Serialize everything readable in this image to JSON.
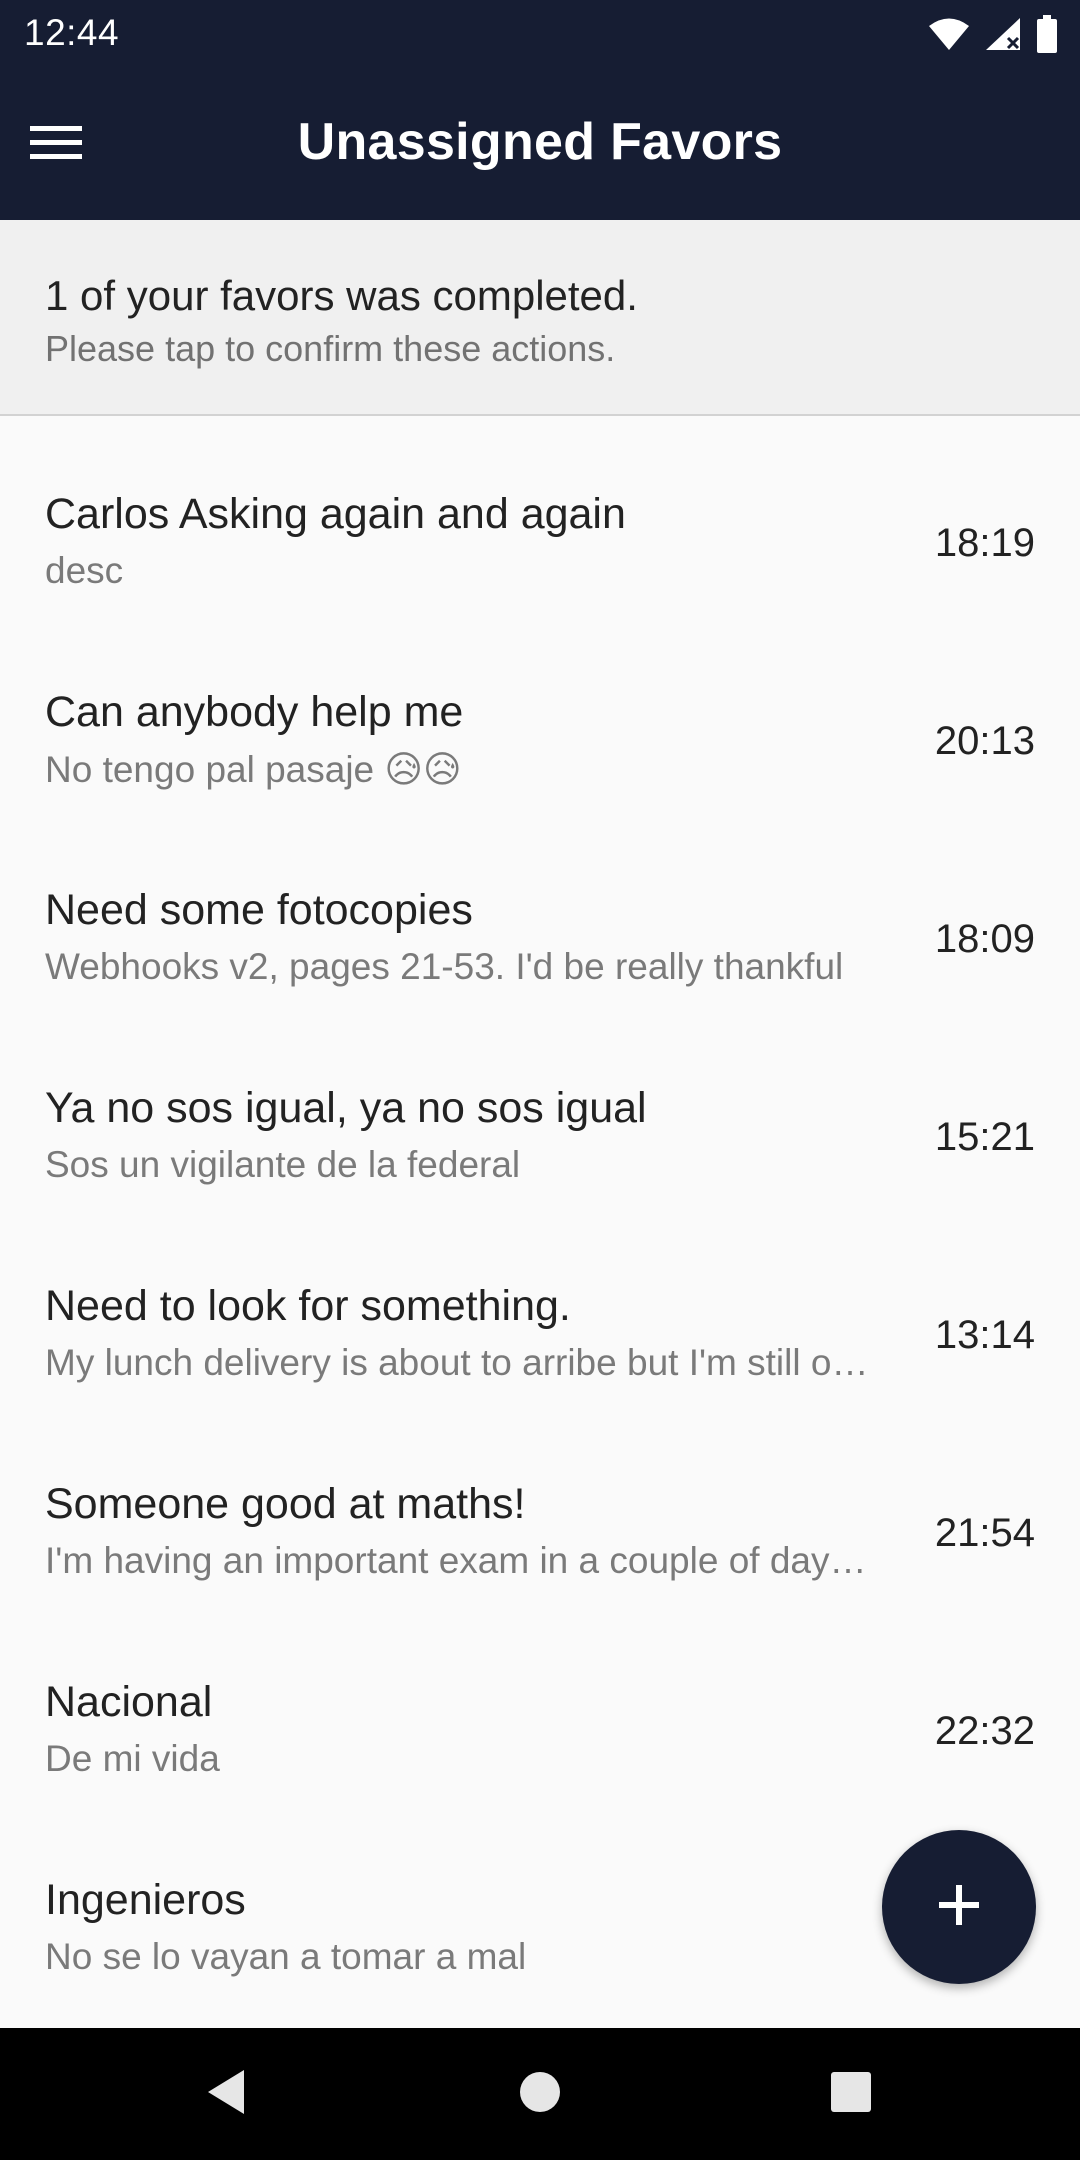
{
  "status_bar": {
    "time": "12:44"
  },
  "app_bar": {
    "title": "Unassigned Favors"
  },
  "banner": {
    "title": "1 of your favors was completed.",
    "subtitle": "Please tap to confirm these actions."
  },
  "favors": [
    {
      "title": "Carlos Asking again and again",
      "description": "desc",
      "time": "18:19"
    },
    {
      "title": "Can anybody help me",
      "description": "No tengo pal pasaje 😥😥",
      "time": "20:13"
    },
    {
      "title": "Need some fotocopies",
      "description": "Webhooks v2, pages 21-53. I'd be really thankful",
      "time": "18:09"
    },
    {
      "title": "Ya no sos igual, ya no sos igual",
      "description": "Sos un vigilante de la federal",
      "time": "15:21"
    },
    {
      "title": "Need to look for something.",
      "description": "My lunch delivery is about to arribe but I'm still o…",
      "time": "13:14"
    },
    {
      "title": "Someone good at maths!",
      "description": "I'm having an important exam in a couple of day…",
      "time": "21:54"
    },
    {
      "title": "Nacional",
      "description": "De mi vida",
      "time": "22:32"
    },
    {
      "title": "Ingenieros",
      "description": "No se lo vayan a tomar a mal",
      "time": ""
    }
  ],
  "icons": {
    "menu": "menu-icon",
    "add": "add-icon",
    "wifi": "wifi-icon",
    "signal": "signal-icon",
    "battery": "battery-icon",
    "back": "back-icon",
    "home": "home-icon",
    "recents": "recents-icon"
  },
  "colors": {
    "primary": "#161d33",
    "background": "#fafafa",
    "banner_background": "#f0f0f0"
  }
}
